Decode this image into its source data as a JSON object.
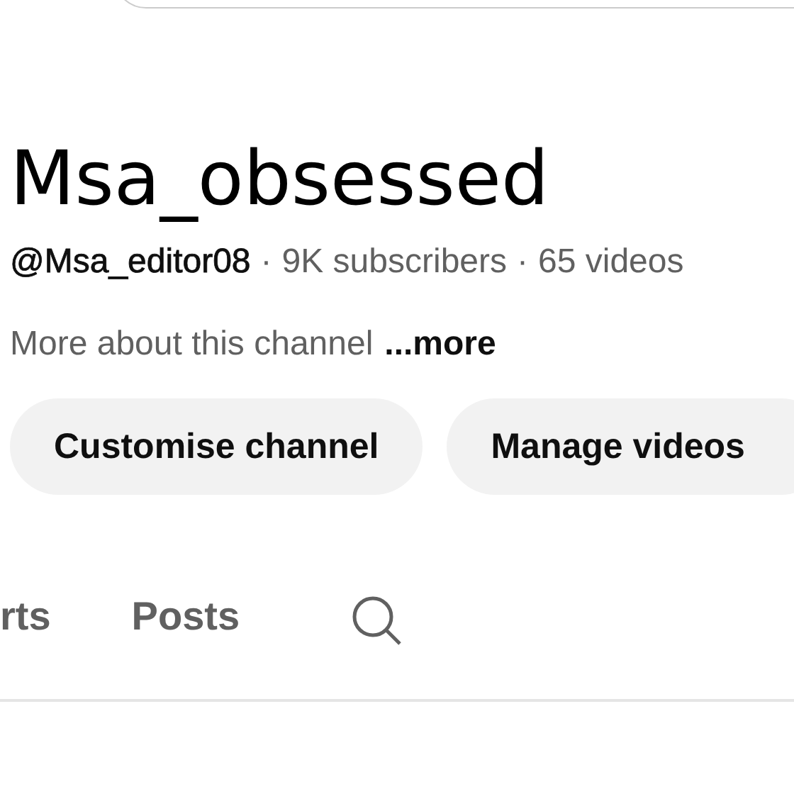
{
  "channel": {
    "name": "Msa_obsessed",
    "handle": "@Msa_editor08",
    "separators": [
      "·",
      "·"
    ],
    "subscribers": "9K subscribers",
    "videos": "65 videos",
    "description": "More about this channel",
    "more_link": "...more"
  },
  "buttons": [
    "Customise channel",
    "Manage videos"
  ],
  "tabs": [
    {
      "label": "rts",
      "selected": false
    },
    {
      "label": "Posts",
      "selected": false
    }
  ]
}
